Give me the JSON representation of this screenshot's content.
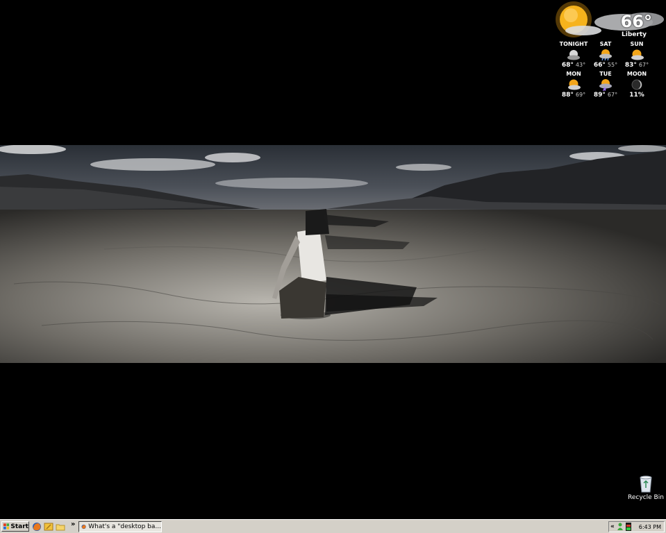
{
  "weather": {
    "current_temp": "66°",
    "city": "Liberty",
    "current_icon": "sun-cloud-icon",
    "forecast": [
      {
        "day": "TONIGHT",
        "hi": "68°",
        "lo": "43°",
        "icon": "moon-cloud-icon"
      },
      {
        "day": "SAT",
        "hi": "66°",
        "lo": "55°",
        "icon": "rain-icon"
      },
      {
        "day": "SUN",
        "hi": "83°",
        "lo": "67°",
        "icon": "partly-sunny-icon"
      },
      {
        "day": "MON",
        "hi": "88°",
        "lo": "69°",
        "icon": "partly-sunny-icon"
      },
      {
        "day": "TUE",
        "hi": "89°",
        "lo": "67°",
        "icon": "thunderstorm-icon"
      },
      {
        "day": "MOON",
        "hi": "11%",
        "lo": "",
        "icon": "moon-phase-icon"
      }
    ]
  },
  "desktop": {
    "recycle_bin_label": "Recycle Bin"
  },
  "taskbar": {
    "start_label": "Start",
    "overflow_label": "»",
    "task_label": "What's a \"desktop ba...",
    "tray_collapse": "«",
    "clock": "6:43 PM"
  },
  "colors": {
    "taskbar": "#d4d0c8",
    "desktop": "#000000"
  }
}
